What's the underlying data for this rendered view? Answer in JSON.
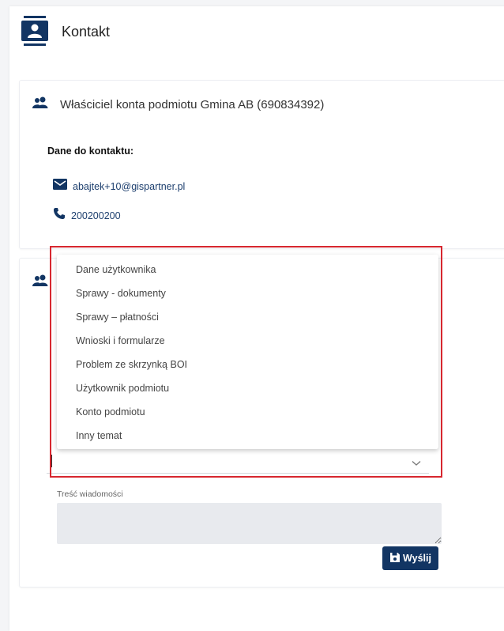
{
  "header": {
    "title": "Kontakt",
    "icon": "contact-book-icon"
  },
  "owner_card": {
    "title": "Właściciel konta podmiotu Gmina AB (690834392)",
    "icon": "users-icon",
    "contact_heading": "Dane do kontaktu:",
    "email": "abajtek+10@gispartner.pl",
    "phone": "200200200"
  },
  "form": {
    "topic_options": [
      "Dane użytkownika",
      "Sprawy - dokumenty",
      "Sprawy – płatności",
      "Wnioski i formularze",
      "Problem ze skrzynką BOI",
      "Użytkownik podmiotu",
      "Konto podmiotu",
      "Inny temat"
    ],
    "topic_value": "",
    "message_label": "Treść wiadomości",
    "message_value": "",
    "send_label": "Wyślij"
  },
  "colors": {
    "primary": "#123563",
    "link": "#1d3f6e",
    "highlight": "#d7272f",
    "field_bg": "#e8eaee"
  }
}
